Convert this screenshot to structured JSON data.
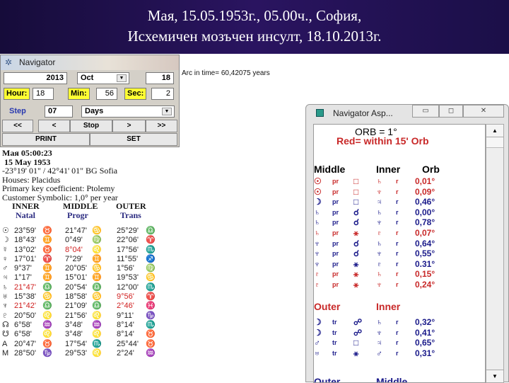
{
  "header": {
    "line1": "Мая, 15.05.1953г., 05.00ч., София,",
    "line2": "Исхемичен мозъчен инсулт, 18.10.2013г."
  },
  "navigator": {
    "title": "Navigator",
    "year": "2013",
    "month": "Oct",
    "day": "18",
    "hour_label": "Hour:",
    "hour": "18",
    "min_label": "Min:",
    "min": "56",
    "sec_label": "Sec:",
    "sec": "2",
    "step_label": "Step",
    "step": "07",
    "step_unit": "Days",
    "buttons": [
      "<<",
      "<",
      "Stop",
      ">",
      ">>"
    ],
    "print": "PRINT",
    "set": "SET",
    "arc": "Arc in time= 60,42075 years"
  },
  "info": {
    "lines": [
      "Мая 05:00:23",
      "15 May 1953",
      "-23°19' 01\" / 42°41' 01\"  BG Sofia",
      "Houses: Placidus",
      "Primary key coefficient: Ptolemy",
      "Customer Symbolic: 1,0° per year"
    ],
    "headers": [
      "INNER",
      "MIDDLE",
      "OUTER"
    ],
    "subheaders": [
      "Natal",
      "Progr",
      "Trans"
    ]
  },
  "positions": [
    {
      "p": "☉",
      "n": "23°59'",
      "ns": "♉",
      "m": "21°47'",
      "ms": "♋",
      "o": "25°29'",
      "os": "♎"
    },
    {
      "p": "☽",
      "n": "18°43'",
      "ns": "♊",
      "m": "0°49'",
      "ms": "♍",
      "o": "22°06'",
      "os": "♈"
    },
    {
      "p": "☿",
      "n": "13°02'",
      "ns": "♉",
      "m": "8°04'",
      "ms": "♌",
      "mr": true,
      "o": "17°56'",
      "os": "♏"
    },
    {
      "p": "♀",
      "n": "17°01'",
      "ns": "♈",
      "m": "7°29'",
      "ms": "♊",
      "o": "11°55'",
      "os": "♐"
    },
    {
      "p": "♂",
      "n": "9°37'",
      "ns": "♊",
      "m": "20°05'",
      "ms": "♋",
      "o": "1°56'",
      "os": "♍"
    },
    {
      "p": "♃",
      "n": "1°17'",
      "ns": "♊",
      "m": "15°01'",
      "ms": "♊",
      "o": "19°53'",
      "os": "♋"
    },
    {
      "p": "♄",
      "n": "21°47'",
      "ns": "♎",
      "nr": true,
      "m": "20°54'",
      "ms": "♎",
      "o": "12°00'",
      "os": "♏"
    },
    {
      "p": "♅",
      "n": "15°38'",
      "ns": "♋",
      "m": "18°58'",
      "ms": "♋",
      "o": "9°56'",
      "os": "♈",
      "or": true
    },
    {
      "p": "♆",
      "n": "21°42'",
      "ns": "♎",
      "nr": true,
      "m": "21°09'",
      "ms": "♎",
      "o": "2°46'",
      "os": "♓",
      "or": true
    },
    {
      "p": "♇",
      "n": "20°50'",
      "ns": "♌",
      "m": "21°56'",
      "ms": "♌",
      "o": "9°11'",
      "os": "♑"
    },
    {
      "p": "☊",
      "n": "6°58'",
      "ns": "♒",
      "m": "3°48'",
      "ms": "♒",
      "o": "8°14'",
      "os": "♏"
    },
    {
      "p": "☋",
      "n": "6°58'",
      "ns": "♌",
      "m": "3°48'",
      "ms": "♌",
      "o": "8°14'",
      "os": "♉"
    },
    {
      "p": "A",
      "n": "20°47'",
      "ns": "♉",
      "m": "17°54'",
      "ms": "♏",
      "o": "25°44'",
      "os": "♉"
    },
    {
      "p": "M",
      "n": "28°50'",
      "ns": "♑",
      "m": "29°53'",
      "ms": "♌",
      "o": "2°24'",
      "os": "♒"
    }
  ],
  "aspects": {
    "title": "Navigator Asp...",
    "orb": "ORB = 1°",
    "legend": "Red= within 15' Orb",
    "sec1_headers": [
      "Middle",
      "Inner",
      "Orb"
    ],
    "sec1": [
      {
        "a": "☉",
        "t": "pr",
        "x": "□",
        "b": "♄",
        "r": "r",
        "orb": "0,01°",
        "red": true
      },
      {
        "a": "☉",
        "t": "pr",
        "x": "□",
        "b": "♆",
        "r": "r",
        "orb": "0,09°",
        "red": true
      },
      {
        "a": "☽",
        "t": "pr",
        "x": "□",
        "b": "♃",
        "r": "r",
        "orb": "0,46°"
      },
      {
        "a": "♄",
        "t": "pr",
        "x": "☌",
        "b": "♄",
        "r": "r",
        "orb": "0,00°"
      },
      {
        "a": "♄",
        "t": "pr",
        "x": "☌",
        "b": "♆",
        "r": "r",
        "orb": "0,78°"
      },
      {
        "a": "♄",
        "t": "pr",
        "x": "⚹",
        "b": "♇",
        "r": "r",
        "orb": "0,07°",
        "red": true
      },
      {
        "a": "♆",
        "t": "pr",
        "x": "☌",
        "b": "♄",
        "r": "r",
        "orb": "0,64°"
      },
      {
        "a": "♆",
        "t": "pr",
        "x": "☌",
        "b": "♆",
        "r": "r",
        "orb": "0,55°"
      },
      {
        "a": "♆",
        "t": "pr",
        "x": "⚹",
        "b": "♇",
        "r": "r",
        "orb": "0.31°"
      },
      {
        "a": "♇",
        "t": "pr",
        "x": "⚹",
        "b": "♄",
        "r": "r",
        "orb": "0,15°",
        "red": true
      },
      {
        "a": "♇",
        "t": "pr",
        "x": "⚹",
        "b": "♆",
        "r": "r",
        "orb": "0,24°",
        "red": true
      }
    ],
    "sec2_headers": [
      "Outer",
      "Inner"
    ],
    "sec2": [
      {
        "a": "☽",
        "t": "tr",
        "x": "☍",
        "b": "♄",
        "r": "r",
        "orb": "0,32°"
      },
      {
        "a": "☽",
        "t": "tr",
        "x": "☍",
        "b": "♆",
        "r": "r",
        "orb": "0,41°"
      },
      {
        "a": "♂",
        "t": "tr",
        "x": "□",
        "b": "♃",
        "r": "r",
        "orb": "0,65°"
      },
      {
        "a": "♅",
        "t": "tr",
        "x": "⚹",
        "b": "♂",
        "r": "r",
        "orb": "0,31°"
      }
    ],
    "sec3_headers": [
      "Outer",
      "Middle"
    ]
  },
  "colors": {
    "red": "#c82828",
    "blue": "#1a1a8a",
    "highlight": "#ffff33"
  }
}
